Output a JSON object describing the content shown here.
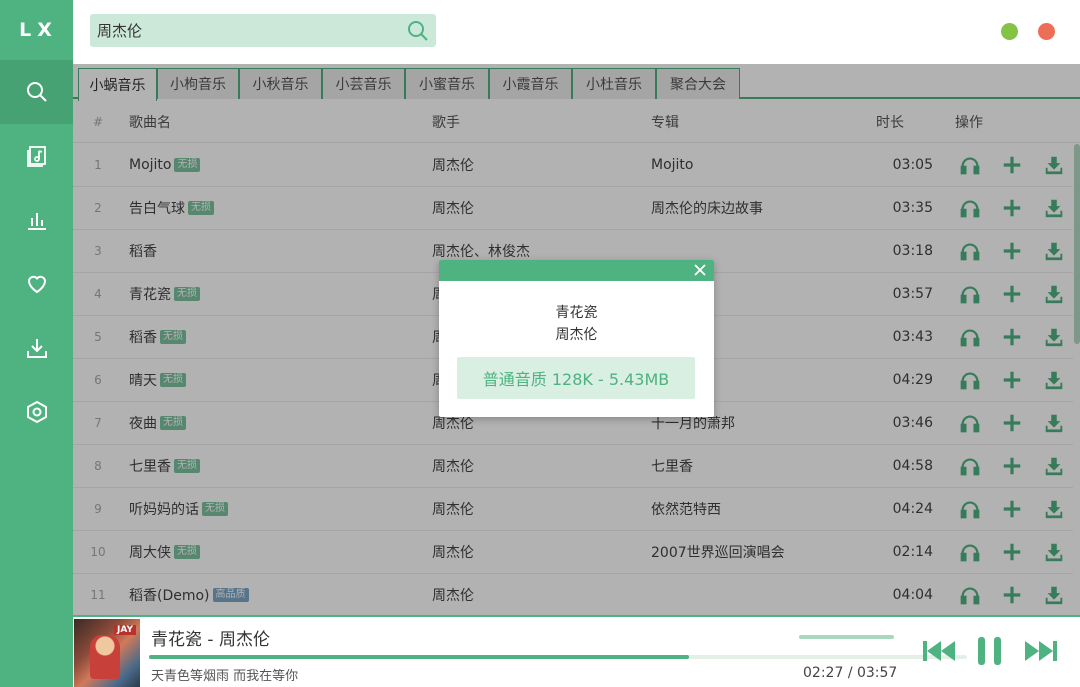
{
  "app": {
    "logo": "LX"
  },
  "search": {
    "value": "周杰伦"
  },
  "colors": {
    "accent": "#4fb281",
    "window_min": "#85c344",
    "window_close": "#ec6e57"
  },
  "sidebar": {
    "items": [
      {
        "icon": "search-icon",
        "active": true
      },
      {
        "icon": "music-list-icon",
        "active": false
      },
      {
        "icon": "chart-icon",
        "active": false
      },
      {
        "icon": "heart-icon",
        "active": false
      },
      {
        "icon": "download-icon",
        "active": false
      },
      {
        "icon": "settings-icon",
        "active": false
      }
    ]
  },
  "tabs": [
    "小蜗音乐",
    "小枸音乐",
    "小秋音乐",
    "小芸音乐",
    "小蜜音乐",
    "小霞音乐",
    "小杜音乐",
    "聚合大会"
  ],
  "table": {
    "headers": {
      "num": "#",
      "name": "歌曲名",
      "singer": "歌手",
      "album": "专辑",
      "duration": "时长",
      "ops": "操作"
    },
    "rows": [
      {
        "num": "1",
        "name": "Mojito",
        "badge": "无损",
        "singer": "周杰伦",
        "album": "Mojito",
        "duration": "03:05"
      },
      {
        "num": "2",
        "name": "告白气球",
        "badge": "无损",
        "singer": "周杰伦",
        "album": "周杰伦的床边故事",
        "duration": "03:35"
      },
      {
        "num": "3",
        "name": "稻香",
        "badge": "",
        "singer": "周杰伦、林俊杰",
        "album": "",
        "duration": "03:18"
      },
      {
        "num": "4",
        "name": "青花瓷",
        "badge": "无损",
        "singer": "周",
        "album": "",
        "duration": "03:57"
      },
      {
        "num": "5",
        "name": "稻香",
        "badge": "无损",
        "singer": "周",
        "album": "",
        "duration": "03:43"
      },
      {
        "num": "6",
        "name": "晴天",
        "badge": "无损",
        "singer": "周",
        "album": "",
        "duration": "04:29"
      },
      {
        "num": "7",
        "name": "夜曲",
        "badge": "无损",
        "singer": "周杰伦",
        "album": "十一月的萧邦",
        "duration": "03:46"
      },
      {
        "num": "8",
        "name": "七里香",
        "badge": "无损",
        "singer": "周杰伦",
        "album": "七里香",
        "duration": "04:58"
      },
      {
        "num": "9",
        "name": "听妈妈的话",
        "badge": "无损",
        "singer": "周杰伦",
        "album": "依然范特西",
        "duration": "04:24"
      },
      {
        "num": "10",
        "name": "周大侠",
        "badge": "无损",
        "singer": "周杰伦",
        "album": "2007世界巡回演唱会",
        "duration": "02:14"
      },
      {
        "num": "11",
        "name": "稻香(Demo)",
        "badge": "高品质",
        "singer": "周杰伦",
        "album": "",
        "duration": "04:04"
      }
    ]
  },
  "modal": {
    "title": "青花瓷",
    "artist": "周杰伦",
    "quality_option": "普通音质 128K - 5.43MB"
  },
  "player": {
    "title": "青花瓷 - 周杰伦",
    "lyric": "天青色等烟雨 而我在等你",
    "current_time": "02:27",
    "time_separator": "/",
    "total_time": "03:57",
    "cover_tag": "JAY",
    "progress": 0.66
  }
}
